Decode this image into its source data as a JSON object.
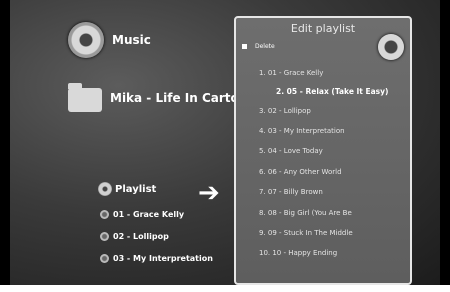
{
  "library": {
    "music_label": "Music",
    "album_label": "Mika - Life In Cartoon Moti"
  },
  "playlist": {
    "label": "Playlist",
    "items": [
      "01 - Grace Kelly",
      "02 - Lollipop",
      "03 - My Interpretation"
    ]
  },
  "arrow": "➔",
  "panel": {
    "title": "Edit playlist",
    "delete_label": "Delete",
    "tracks": [
      "1. 01 - Grace Kelly",
      "2. 05 - Relax (Take It Easy)",
      "3. 02 - Lollipop",
      "4. 03 - My Interpretation",
      "5. 04 - Love Today",
      "6. 06 - Any Other World",
      "7. 07 - Billy Brown",
      "8. 08 - Big Girl (You Are Be",
      "9. 09 - Stuck In The Middle",
      "10. 10 - Happy Ending"
    ],
    "selected_index": 1
  }
}
